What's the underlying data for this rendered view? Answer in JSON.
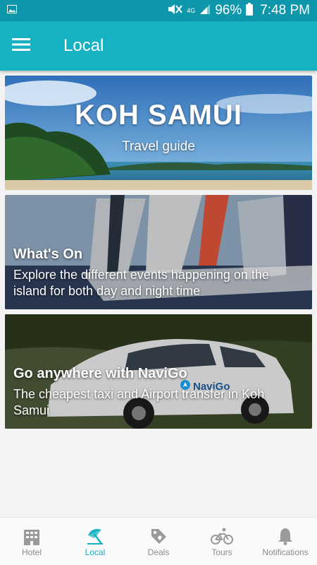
{
  "status_bar": {
    "battery": "96%",
    "time": "7:48 PM",
    "network": "4G"
  },
  "app_bar": {
    "title": "Local"
  },
  "cards": [
    {
      "title": "KOH SAMUI",
      "subtitle": "Travel guide"
    },
    {
      "title": "What's On",
      "description": "Explore the different events happening on the island for both day and night time"
    },
    {
      "title": "Go anywhere with NaviGo",
      "description": "The cheapest taxi and Airport transfer in Koh Samui",
      "brand": "NaviGo"
    }
  ],
  "bottom_nav": {
    "items": [
      {
        "label": "Hotel",
        "icon": "hotel-icon",
        "active": false
      },
      {
        "label": "Local",
        "icon": "beach-umbrella-icon",
        "active": true
      },
      {
        "label": "Deals",
        "icon": "tag-icon",
        "active": false
      },
      {
        "label": "Tours",
        "icon": "bicycle-icon",
        "active": false
      },
      {
        "label": "Notifications",
        "icon": "bell-icon",
        "active": false
      }
    ]
  },
  "colors": {
    "status_bar": "#0e97ab",
    "app_bar": "#17b1c4",
    "active_nav": "#17b1c4",
    "inactive_nav": "#8a8a8a"
  }
}
